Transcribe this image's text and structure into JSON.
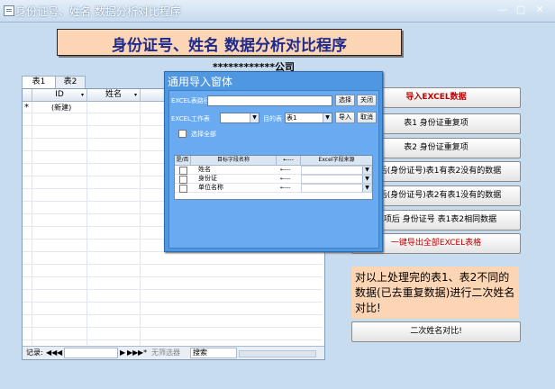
{
  "window": {
    "title": "身份证号、姓名 数据分析对比程序",
    "minimize": "—",
    "maximize": "□",
    "close": "✕"
  },
  "banner": {
    "title": "身份证号、姓名  数据分析对比程序"
  },
  "company": "************公司",
  "tabs": [
    "表1",
    "表2"
  ],
  "grid": {
    "columns": [
      "ID",
      "姓名"
    ],
    "new_row_marker": "*",
    "new_row_value": "(新建)",
    "nav": {
      "record_label": "记录:",
      "first": "◀◀",
      "prev": "◀",
      "next": "▶",
      "last": "▶▶",
      "new": "▶*",
      "filter": "无筛选器",
      "search": "搜索"
    }
  },
  "dialog": {
    "title": "通用导入窗体",
    "excel_path_label": "EXCEL表路径",
    "excel_path_value": "",
    "choose_button": "选择",
    "close_button": "关闭",
    "worksheet_label": "EXCEL工作表",
    "worksheet_value": "",
    "target_table_label": "目的表",
    "target_table_value": "表1",
    "import_button": "导入",
    "cancel_button": "取消",
    "select_all_label": "选择全部",
    "mapping_headers": [
      "是/否",
      "目标字段名称",
      "←---",
      "Excel字段来源"
    ],
    "mapping_rows": [
      {
        "field": "姓名",
        "arrow": "←---",
        "source": ""
      },
      {
        "field": "身份证",
        "arrow": "←---",
        "source": ""
      },
      {
        "field": "单位名称",
        "arrow": "←---",
        "source": ""
      }
    ]
  },
  "actions": {
    "import_excel": "导入EXCEL数据",
    "dup_table1": "表1 身份证重复项",
    "dup_table2": "表2 身份证重复项",
    "only_in_1": "项后(身份证号)表1有表2没有的数据",
    "only_in_2": "项后(身份证号)表2有表1没有的数据",
    "common": "复项后 身份证号 表1表2相同数据",
    "export_all": "一键导出全部EXCEL表格",
    "note": "对以上处理完的表1、表2不同的数据(已去重复数据)进行二次姓名对比!",
    "second_compare": "二次姓名对比!"
  },
  "colors": {
    "accent_red": "#c00000",
    "banner_text": "#1f2a8a",
    "dialog_blue": "#4f97e0",
    "peach": "#fcd5b4"
  }
}
